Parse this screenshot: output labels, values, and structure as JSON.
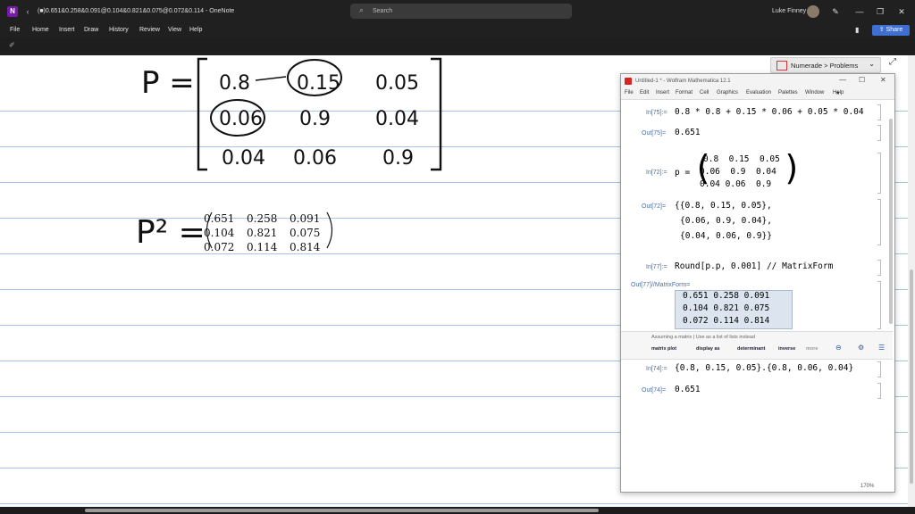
{
  "titlebar": {
    "app_logo": "N",
    "title": "(■)0.651&0.258&0.091@0.104&0.821&0.075@0.072&0.114 - OneNote",
    "search_placeholder": "Search",
    "user_name": "Luke Finney"
  },
  "ribbon": {
    "menus": [
      "File",
      "Home",
      "Insert",
      "Draw",
      "History",
      "Review",
      "View",
      "Help"
    ],
    "share": "Share"
  },
  "notes": {
    "p_label": "P =",
    "p_matrix": [
      [
        "0.8",
        "0.15",
        "0.05"
      ],
      [
        "0.06",
        "0.9",
        "0.04"
      ],
      [
        "0.04",
        "0.06",
        "0.9"
      ]
    ],
    "p2_label": "P² =",
    "p2_matrix": [
      [
        "0.651",
        "0.258",
        "0.091"
      ],
      [
        "0.104",
        "0.821",
        "0.075"
      ],
      [
        "0.072",
        "0.114",
        "0.814"
      ]
    ]
  },
  "numerade": {
    "label": "Numerade > Problems"
  },
  "mathematica": {
    "title": "Untitled-1 * - Wolfram Mathematica 12.1",
    "menus": [
      "File",
      "Edit",
      "Insert",
      "Format",
      "Cell",
      "Graphics",
      "Evaluation",
      "Palettes",
      "Window",
      "Help"
    ],
    "cells": {
      "in75_label": "In[75]:=",
      "in75_code": "0.8 * 0.8 + 0.15 * 0.06 + 0.05 * 0.04",
      "out75_label": "Out[75]=",
      "out75_value": "0.651",
      "in72_label": "In[72]:=",
      "in72_var": "p =",
      "in72_matrix": [
        [
          "0.8",
          "0.15",
          "0.05"
        ],
        [
          "0.06",
          "0.9",
          "0.04"
        ],
        [
          "0.04",
          "0.06",
          "0.9"
        ]
      ],
      "out72_label": "Out[72]=",
      "out72_lines": [
        "{{0.8, 0.15, 0.05},",
        "{0.06, 0.9, 0.04},",
        "{0.04, 0.06, 0.9}}"
      ],
      "in77_label": "In[77]:=",
      "in77_code": "Round[p.p, 0.001] // MatrixForm",
      "out77_label": "Out[77]//MatrixForm=",
      "out77_rows": [
        "0.651  0.258  0.091",
        "0.104  0.821  0.075",
        "0.072  0.114  0.814"
      ],
      "in74_label": "In[74]:=",
      "in74_code": "{0.8, 0.15, 0.05}.{0.8, 0.06, 0.04}",
      "out74_label": "Out[74]=",
      "out74_value": "0.651"
    },
    "suggest": {
      "hint": "Assuming a matrix | Use as a list of lists instead",
      "buttons": [
        "matrix plot",
        "display as",
        "determinant",
        "inverse",
        "more"
      ]
    },
    "zoom": "170%"
  }
}
